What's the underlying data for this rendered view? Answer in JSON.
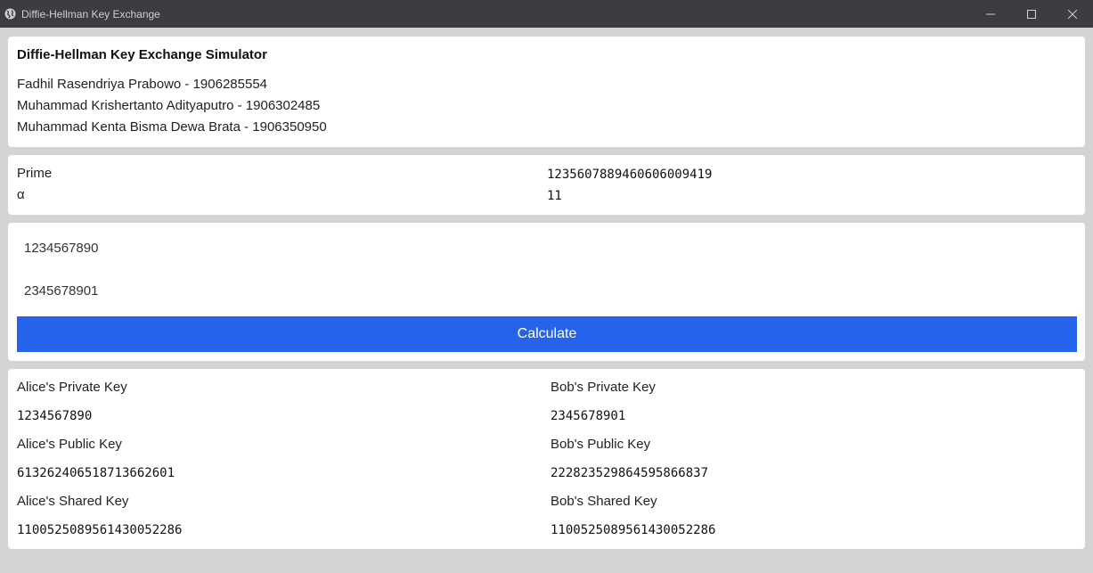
{
  "window": {
    "title": "Diffie-Hellman Key Exchange",
    "icon": "globe-icon",
    "controls": [
      "minimize-icon",
      "maximize-icon",
      "close-icon"
    ]
  },
  "header": {
    "title": "Diffie-Hellman Key Exchange Simulator",
    "authors": [
      "Fadhil Rasendriya Prabowo - 1906285554",
      "Muhammad Krishertanto Adityaputro - 1906302485",
      "Muhammad Kenta Bisma Dewa Brata - 1906350950"
    ]
  },
  "params": {
    "prime_label": "Prime",
    "prime_value": "1235607889460606009419",
    "alpha_label": "α",
    "alpha_value": "11"
  },
  "inputs": {
    "alice_private": "1234567890",
    "bob_private": "2345678901",
    "calculate_label": "Calculate"
  },
  "results": {
    "alice": {
      "private_label": "Alice's Private Key",
      "private_value": "1234567890",
      "public_label": "Alice's Public Key",
      "public_value": "613262406518713662601",
      "shared_label": "Alice's Shared Key",
      "shared_value": "1100525089561430052286"
    },
    "bob": {
      "private_label": "Bob's Private Key",
      "private_value": "2345678901",
      "public_label": "Bob's Public Key",
      "public_value": "222823529864595866837",
      "shared_label": "Bob's Shared Key",
      "shared_value": "1100525089561430052286"
    }
  },
  "colors": {
    "accent": "#2563eb",
    "titlebar": "#3b3d40",
    "background": "#d4d4d4",
    "card": "#ffffff"
  }
}
